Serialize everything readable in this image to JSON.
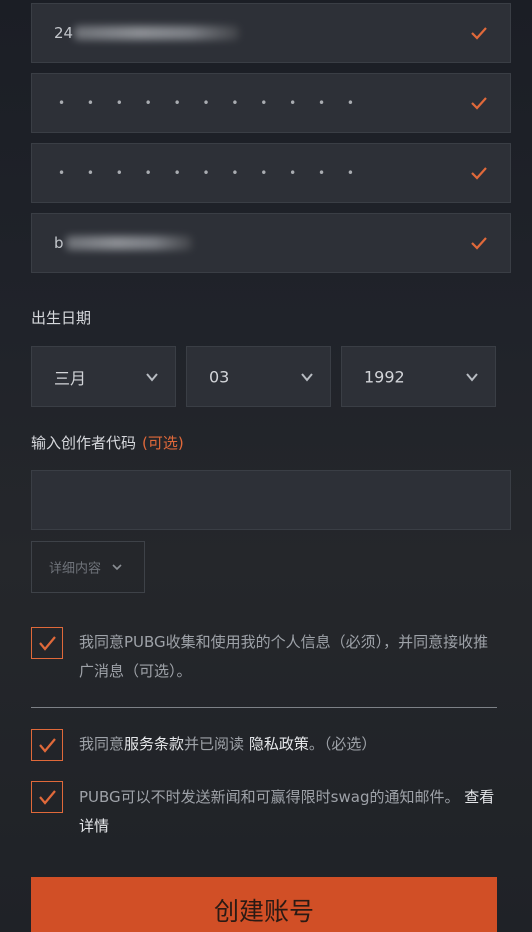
{
  "fields": {
    "id_value": "24",
    "password_dots": "• • • • • • • • • • •",
    "confirm_dots": "• • • • • • • • • • •",
    "name_value": "b"
  },
  "birthdate": {
    "label": "出生日期",
    "month": "三月",
    "day": "03",
    "year": "1992"
  },
  "creator_code": {
    "label": "输入创作者代码",
    "optional": "(可选)",
    "value": ""
  },
  "details_button": "详细内容",
  "consents": [
    {
      "text": "我同意PUBG收集和使用我的个人信息（必须），并同意接收推广消息（可选）。",
      "checked": true
    },
    {
      "prefix": "我同意",
      "terms": "服务条款",
      "middle": "并已阅读 ",
      "privacy": "隐私政策",
      "suffix": "。（必选）",
      "checked": true
    },
    {
      "text": "PUBG可以不时发送新闻和可赢得限时swag的通知邮件。",
      "link": "查看详情",
      "checked": true
    }
  ],
  "create_button": "创建账号",
  "colors": {
    "accent": "#e0693a",
    "button": "#d14f26",
    "field_bg": "#2d3037"
  }
}
